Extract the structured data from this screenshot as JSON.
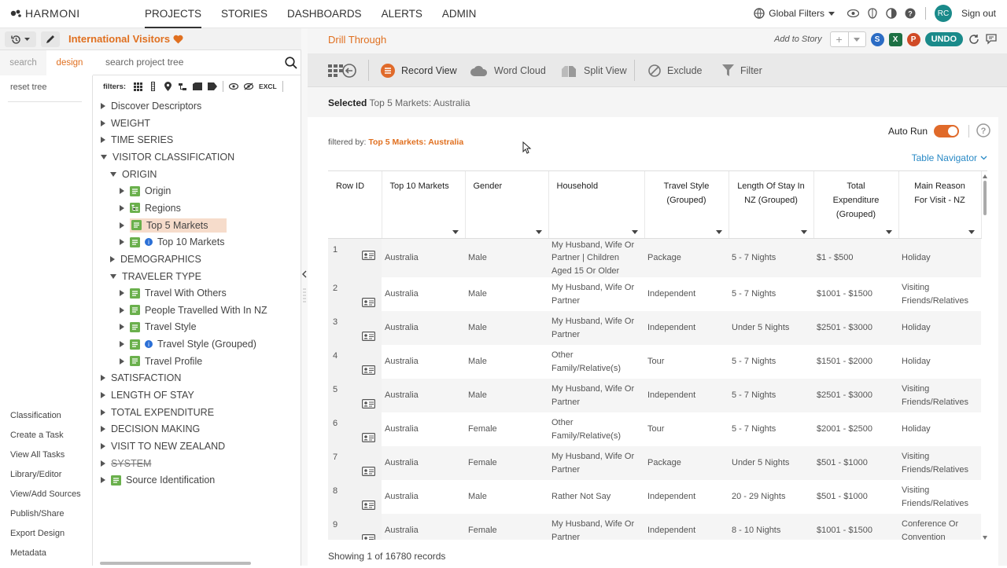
{
  "brand": {
    "name": "HARMONI"
  },
  "nav": {
    "items": [
      "PROJECTS",
      "STORIES",
      "DASHBOARDS",
      "ALERTS",
      "ADMIN"
    ],
    "active": "PROJECTS"
  },
  "topright": {
    "global_filters": "Global Filters",
    "avatar": "RC",
    "sign_out": "Sign out"
  },
  "project": {
    "title": "International Visitors"
  },
  "left_tabs": {
    "search": "search",
    "design": "design"
  },
  "search": {
    "placeholder": "search project tree"
  },
  "reset_tree": "reset tree",
  "filters_label": "filters:",
  "filters_excl": "EXCL",
  "tree": {
    "nodes": [
      {
        "label": "Discover Descriptors",
        "level": 0,
        "state": "collapsed"
      },
      {
        "label": "WEIGHT",
        "level": 0,
        "state": "collapsed"
      },
      {
        "label": "TIME SERIES",
        "level": 0,
        "state": "collapsed"
      },
      {
        "label": "VISITOR CLASSIFICATION",
        "level": 0,
        "state": "expanded"
      },
      {
        "label": "ORIGIN",
        "level": 1,
        "state": "expanded"
      },
      {
        "label": "Origin",
        "level": 2,
        "state": "collapsed",
        "icon": "question-icon"
      },
      {
        "label": "Regions",
        "level": 2,
        "state": "collapsed",
        "icon": "hierarchy-icon"
      },
      {
        "label": "Top 5 Markets",
        "level": 2,
        "state": "collapsed",
        "icon": "question-icon",
        "selected": true
      },
      {
        "label": "Top 10 Markets",
        "level": 2,
        "state": "collapsed",
        "icon": "question-icon",
        "info": true
      },
      {
        "label": "DEMOGRAPHICS",
        "level": 1,
        "state": "collapsed"
      },
      {
        "label": "TRAVELER TYPE",
        "level": 1,
        "state": "expanded"
      },
      {
        "label": "Travel With Others",
        "level": 2,
        "state": "collapsed",
        "icon": "question-icon"
      },
      {
        "label": "People Travelled With In NZ",
        "level": 2,
        "state": "collapsed",
        "icon": "question-icon"
      },
      {
        "label": "Travel Style",
        "level": 2,
        "state": "collapsed",
        "icon": "question-icon"
      },
      {
        "label": "Travel Style (Grouped)",
        "level": 2,
        "state": "collapsed",
        "icon": "question-icon",
        "info": true
      },
      {
        "label": "Travel Profile",
        "level": 2,
        "state": "collapsed",
        "icon": "question-icon"
      },
      {
        "label": "SATISFACTION",
        "level": 0,
        "state": "collapsed"
      },
      {
        "label": "LENGTH OF STAY",
        "level": 0,
        "state": "collapsed"
      },
      {
        "label": "TOTAL EXPENDITURE",
        "level": 0,
        "state": "collapsed"
      },
      {
        "label": "DECISION MAKING",
        "level": 0,
        "state": "collapsed"
      },
      {
        "label": "VISIT TO NEW ZEALAND",
        "level": 0,
        "state": "collapsed"
      },
      {
        "label": "SYSTEM",
        "level": 0,
        "state": "collapsed",
        "strike": true
      },
      {
        "label": "Source Identification",
        "level": 0,
        "state": "collapsed",
        "icon": "question-icon"
      }
    ]
  },
  "leftnav": {
    "links": [
      "Classification",
      "Create a Task",
      "View All Tasks",
      "Library/Editor",
      "View/Add Sources",
      "Publish/Share",
      "Export Design",
      "Metadata"
    ]
  },
  "drill": {
    "title": "Drill Through",
    "add_to_story": "Add to Story",
    "undo": "UNDO",
    "toolbar": {
      "record_view": "Record View",
      "word_cloud": "Word Cloud",
      "split_view": "Split View",
      "exclude": "Exclude",
      "filter": "Filter"
    },
    "selected_label": "Selected",
    "selected_value": "Top 5 Markets: Australia",
    "auto_run": "Auto Run",
    "filtered_by_label": "filtered by:",
    "filtered_by_value": "Top 5 Markets: Australia",
    "table_navigator": "Table Navigator",
    "status": "Showing 1 of 16780 records"
  },
  "table": {
    "headers": [
      "Row ID",
      "Top 10 Markets",
      "Gender",
      "Household",
      "Travel Style (Grouped)",
      "Length Of Stay In NZ (Grouped)",
      "Total Expenditure (Grouped)",
      "Main Reason For Visit - NZ"
    ],
    "rows": [
      [
        "1",
        "Australia",
        "Male",
        "My Husband, Wife Or Partner | Children Aged 15 Or Older",
        "Package",
        "5 - 7 Nights",
        "$1 - $500",
        "Holiday"
      ],
      [
        "2",
        "Australia",
        "Male",
        "My Husband, Wife Or Partner",
        "Independent",
        "5 - 7 Nights",
        "$1001 - $1500",
        "Visiting Friends/Relatives"
      ],
      [
        "3",
        "Australia",
        "Male",
        "My Husband, Wife Or Partner",
        "Independent",
        "Under 5 Nights",
        "$2501 - $3000",
        "Holiday"
      ],
      [
        "4",
        "Australia",
        "Male",
        "Other Family/Relative(s)",
        "Tour",
        "5 - 7 Nights",
        "$1501 - $2000",
        "Holiday"
      ],
      [
        "5",
        "Australia",
        "Male",
        "My Husband, Wife Or Partner",
        "Independent",
        "5 - 7 Nights",
        "$2501 - $3000",
        "Visiting Friends/Relatives"
      ],
      [
        "6",
        "Australia",
        "Female",
        "Other Family/Relative(s)",
        "Tour",
        "5 - 7 Nights",
        "$2001 - $2500",
        "Holiday"
      ],
      [
        "7",
        "Australia",
        "Female",
        "My Husband, Wife Or Partner",
        "Package",
        "Under 5 Nights",
        "$501 - $1000",
        "Visiting Friends/Relatives"
      ],
      [
        "8",
        "Australia",
        "Male",
        "Rather Not Say",
        "Independent",
        "20 - 29 Nights",
        "$501 - $1000",
        "Visiting Friends/Relatives"
      ],
      [
        "9",
        "Australia",
        "Female",
        "My Husband, Wife Or Partner",
        "Independent",
        "8 - 10 Nights",
        "$1001 - $1500",
        "Conference Or Convention"
      ]
    ]
  },
  "colors": {
    "accent": "#e07020",
    "teal": "#1a8a8a",
    "link": "#2a8ac6",
    "selected_bg": "#f6dccb"
  }
}
